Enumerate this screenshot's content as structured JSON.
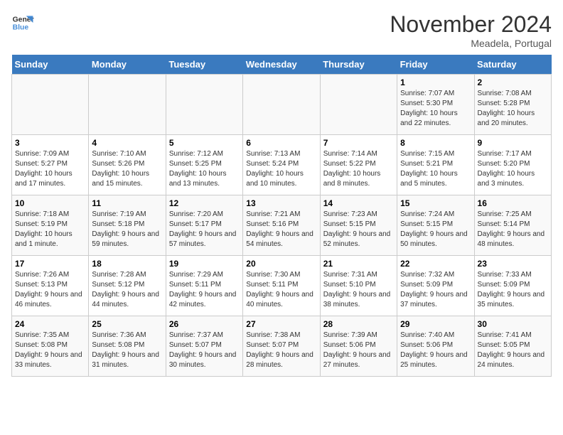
{
  "logo": {
    "line1": "General",
    "line2": "Blue"
  },
  "title": "November 2024",
  "location": "Meadela, Portugal",
  "weekdays": [
    "Sunday",
    "Monday",
    "Tuesday",
    "Wednesday",
    "Thursday",
    "Friday",
    "Saturday"
  ],
  "weeks": [
    [
      {
        "day": "",
        "info": ""
      },
      {
        "day": "",
        "info": ""
      },
      {
        "day": "",
        "info": ""
      },
      {
        "day": "",
        "info": ""
      },
      {
        "day": "",
        "info": ""
      },
      {
        "day": "1",
        "info": "Sunrise: 7:07 AM\nSunset: 5:30 PM\nDaylight: 10 hours and 22 minutes."
      },
      {
        "day": "2",
        "info": "Sunrise: 7:08 AM\nSunset: 5:28 PM\nDaylight: 10 hours and 20 minutes."
      }
    ],
    [
      {
        "day": "3",
        "info": "Sunrise: 7:09 AM\nSunset: 5:27 PM\nDaylight: 10 hours and 17 minutes."
      },
      {
        "day": "4",
        "info": "Sunrise: 7:10 AM\nSunset: 5:26 PM\nDaylight: 10 hours and 15 minutes."
      },
      {
        "day": "5",
        "info": "Sunrise: 7:12 AM\nSunset: 5:25 PM\nDaylight: 10 hours and 13 minutes."
      },
      {
        "day": "6",
        "info": "Sunrise: 7:13 AM\nSunset: 5:24 PM\nDaylight: 10 hours and 10 minutes."
      },
      {
        "day": "7",
        "info": "Sunrise: 7:14 AM\nSunset: 5:22 PM\nDaylight: 10 hours and 8 minutes."
      },
      {
        "day": "8",
        "info": "Sunrise: 7:15 AM\nSunset: 5:21 PM\nDaylight: 10 hours and 5 minutes."
      },
      {
        "day": "9",
        "info": "Sunrise: 7:17 AM\nSunset: 5:20 PM\nDaylight: 10 hours and 3 minutes."
      }
    ],
    [
      {
        "day": "10",
        "info": "Sunrise: 7:18 AM\nSunset: 5:19 PM\nDaylight: 10 hours and 1 minute."
      },
      {
        "day": "11",
        "info": "Sunrise: 7:19 AM\nSunset: 5:18 PM\nDaylight: 9 hours and 59 minutes."
      },
      {
        "day": "12",
        "info": "Sunrise: 7:20 AM\nSunset: 5:17 PM\nDaylight: 9 hours and 57 minutes."
      },
      {
        "day": "13",
        "info": "Sunrise: 7:21 AM\nSunset: 5:16 PM\nDaylight: 9 hours and 54 minutes."
      },
      {
        "day": "14",
        "info": "Sunrise: 7:23 AM\nSunset: 5:15 PM\nDaylight: 9 hours and 52 minutes."
      },
      {
        "day": "15",
        "info": "Sunrise: 7:24 AM\nSunset: 5:15 PM\nDaylight: 9 hours and 50 minutes."
      },
      {
        "day": "16",
        "info": "Sunrise: 7:25 AM\nSunset: 5:14 PM\nDaylight: 9 hours and 48 minutes."
      }
    ],
    [
      {
        "day": "17",
        "info": "Sunrise: 7:26 AM\nSunset: 5:13 PM\nDaylight: 9 hours and 46 minutes."
      },
      {
        "day": "18",
        "info": "Sunrise: 7:28 AM\nSunset: 5:12 PM\nDaylight: 9 hours and 44 minutes."
      },
      {
        "day": "19",
        "info": "Sunrise: 7:29 AM\nSunset: 5:11 PM\nDaylight: 9 hours and 42 minutes."
      },
      {
        "day": "20",
        "info": "Sunrise: 7:30 AM\nSunset: 5:11 PM\nDaylight: 9 hours and 40 minutes."
      },
      {
        "day": "21",
        "info": "Sunrise: 7:31 AM\nSunset: 5:10 PM\nDaylight: 9 hours and 38 minutes."
      },
      {
        "day": "22",
        "info": "Sunrise: 7:32 AM\nSunset: 5:09 PM\nDaylight: 9 hours and 37 minutes."
      },
      {
        "day": "23",
        "info": "Sunrise: 7:33 AM\nSunset: 5:09 PM\nDaylight: 9 hours and 35 minutes."
      }
    ],
    [
      {
        "day": "24",
        "info": "Sunrise: 7:35 AM\nSunset: 5:08 PM\nDaylight: 9 hours and 33 minutes."
      },
      {
        "day": "25",
        "info": "Sunrise: 7:36 AM\nSunset: 5:08 PM\nDaylight: 9 hours and 31 minutes."
      },
      {
        "day": "26",
        "info": "Sunrise: 7:37 AM\nSunset: 5:07 PM\nDaylight: 9 hours and 30 minutes."
      },
      {
        "day": "27",
        "info": "Sunrise: 7:38 AM\nSunset: 5:07 PM\nDaylight: 9 hours and 28 minutes."
      },
      {
        "day": "28",
        "info": "Sunrise: 7:39 AM\nSunset: 5:06 PM\nDaylight: 9 hours and 27 minutes."
      },
      {
        "day": "29",
        "info": "Sunrise: 7:40 AM\nSunset: 5:06 PM\nDaylight: 9 hours and 25 minutes."
      },
      {
        "day": "30",
        "info": "Sunrise: 7:41 AM\nSunset: 5:05 PM\nDaylight: 9 hours and 24 minutes."
      }
    ]
  ]
}
